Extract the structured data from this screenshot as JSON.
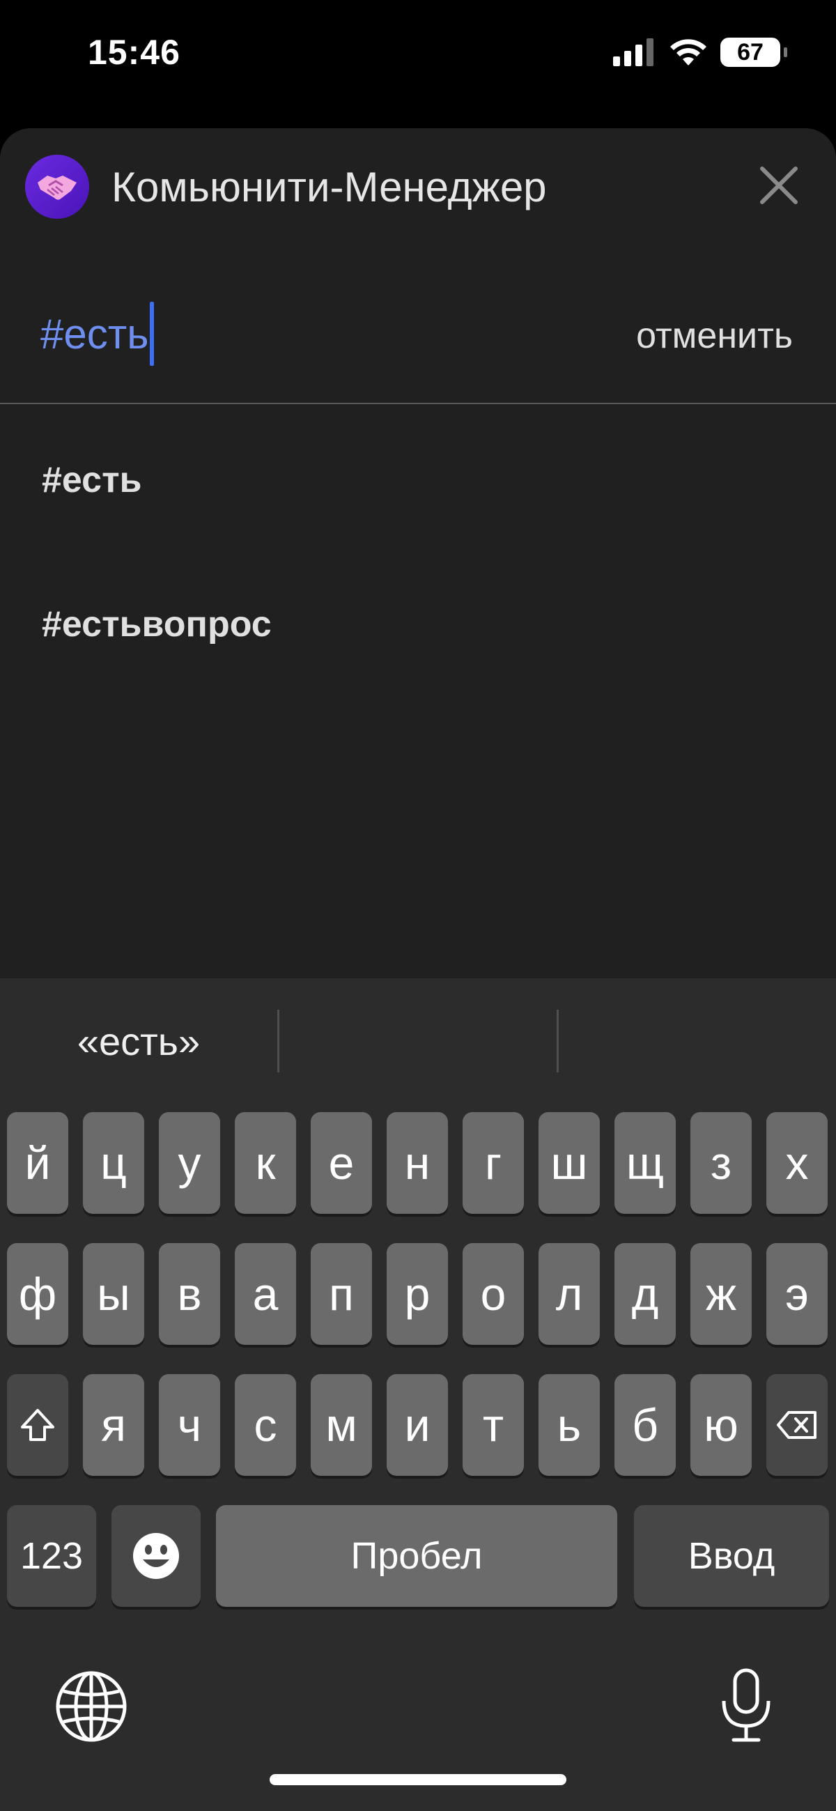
{
  "status_bar": {
    "time": "15:46",
    "battery": "67"
  },
  "sheet": {
    "app_title": "Комьюнити-Менеджер",
    "search_value": "#есть",
    "cancel_label": "отменить",
    "suggestions": [
      "#есть",
      "#естьвопрос"
    ]
  },
  "keyboard": {
    "predictions": [
      "«есть»",
      "",
      ""
    ],
    "row1": [
      "й",
      "ц",
      "у",
      "к",
      "е",
      "н",
      "г",
      "ш",
      "щ",
      "з",
      "х"
    ],
    "row2": [
      "ф",
      "ы",
      "в",
      "а",
      "п",
      "р",
      "о",
      "л",
      "д",
      "ж",
      "э"
    ],
    "row3": [
      "я",
      "ч",
      "с",
      "м",
      "и",
      "т",
      "ь",
      "б",
      "ю"
    ],
    "numbers_label": "123",
    "space_label": "Пробел",
    "return_label": "Ввод"
  },
  "colors": {
    "accent": "#3b6ff5",
    "search_text": "#6f8ff0",
    "sheet_bg": "#202020",
    "keyboard_bg": "#2c2c2c",
    "key_bg": "#6b6b6b"
  }
}
